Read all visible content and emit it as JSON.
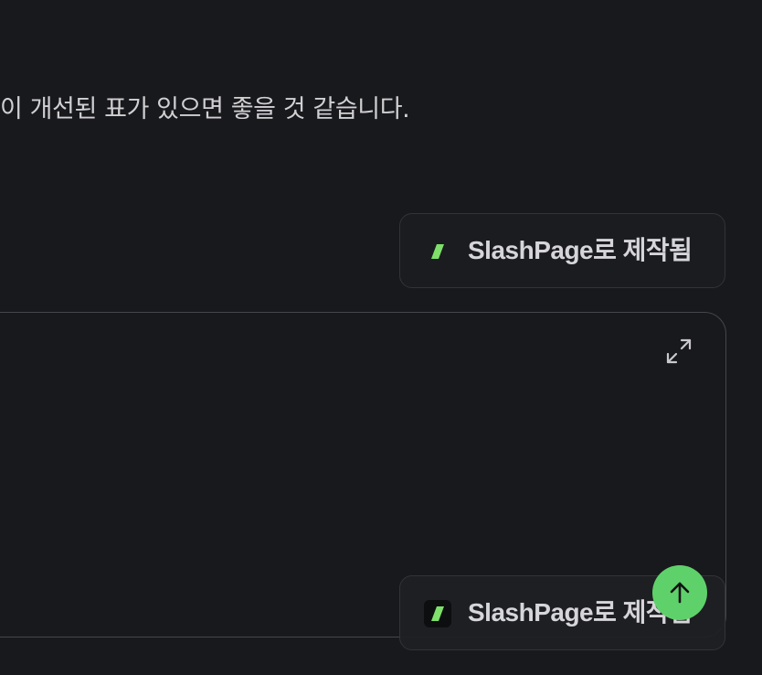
{
  "content": {
    "paragraph_fragment": "이 개선된 표가 있으면 좋을 것 같습니다."
  },
  "badge": {
    "label": "SlashPage로 제작됨",
    "logo_icon": "slashpage-logo-icon",
    "accent_color": "#7ee06a"
  },
  "embed": {
    "expand_icon": "expand-icon"
  },
  "scroll_top": {
    "icon": "arrow-up-icon",
    "color": "#5fd16a"
  }
}
